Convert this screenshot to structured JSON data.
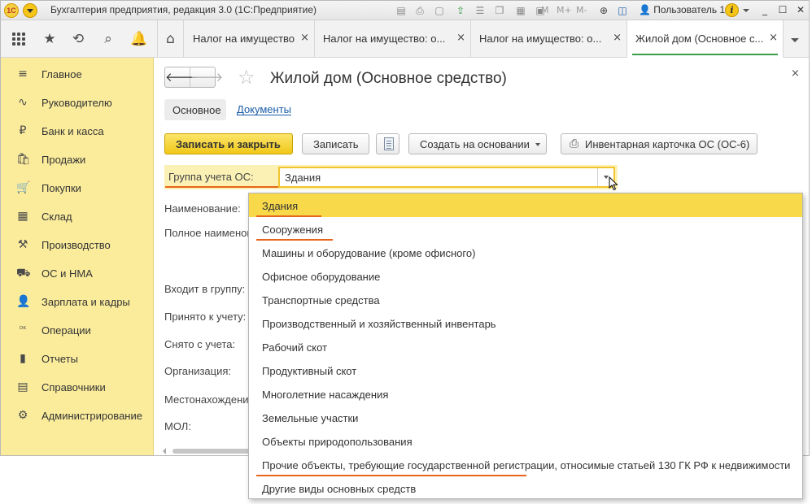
{
  "window": {
    "title": "Бухгалтерия предприятия, редакция 3.0  (1С:Предприятие)",
    "logo_text": "1С",
    "m_labels": [
      "M",
      "M+",
      "M-"
    ],
    "user": "Пользователь 1"
  },
  "tabs": [
    {
      "label": "Налог на имущество",
      "close": "×"
    },
    {
      "label": "Налог на имущество: о...",
      "close": "×"
    },
    {
      "label": "Налог на имущество: о...",
      "close": "×"
    },
    {
      "label": "Жилой дом (Основное с...",
      "close": "×",
      "active": true
    }
  ],
  "sidebar": {
    "items": [
      {
        "label": "Главное",
        "icon": "menu-lines-icon",
        "glyph": "≡"
      },
      {
        "label": "Руководителю",
        "icon": "chart-line-icon",
        "glyph": "∿"
      },
      {
        "label": "Банк и касса",
        "icon": "coin-icon",
        "glyph": "₽"
      },
      {
        "label": "Продажи",
        "icon": "cart-out-icon",
        "glyph": "🛍"
      },
      {
        "label": "Покупки",
        "icon": "cart-icon",
        "glyph": "🛒"
      },
      {
        "label": "Склад",
        "icon": "warehouse-icon",
        "glyph": "▦"
      },
      {
        "label": "Производство",
        "icon": "factory-icon",
        "glyph": "⚒"
      },
      {
        "label": "ОС и НМА",
        "icon": "car-icon",
        "glyph": "⛟"
      },
      {
        "label": "Зарплата и кадры",
        "icon": "person-icon",
        "glyph": "👤"
      },
      {
        "label": "Операции",
        "icon": "dt-kt-icon",
        "glyph": "ᴰᴷ"
      },
      {
        "label": "Отчеты",
        "icon": "bar-chart-icon",
        "glyph": "▮"
      },
      {
        "label": "Справочники",
        "icon": "book-icon",
        "glyph": "▤"
      },
      {
        "label": "Администрирование",
        "icon": "gear-icon",
        "glyph": "⚙"
      }
    ]
  },
  "form": {
    "title": "Жилой дом (Основное средство)",
    "close": "×",
    "subtabs": {
      "main": "Основное",
      "docs": "Документы"
    },
    "buttons": {
      "save_close": "Записать и закрыть",
      "save": "Записать",
      "create_based": "Создать на основании",
      "inventory_card": "Инвентарная карточка ОС (ОС-6)"
    },
    "fields": {
      "group_label": "Группа учета ОС:",
      "group_value": "Здания",
      "name_label": "Наименование:",
      "full_name_label": "Полное наименов",
      "parent_label": "Входит в группу:",
      "accepted_label": "Принято к учету:",
      "removed_label": "Снято с учета:",
      "org_label": "Организация:",
      "location_label": "Местонахождени",
      "mol_label": "МОЛ:"
    }
  },
  "dropdown": {
    "selected": "Здания",
    "options": [
      "Здания",
      "Сооружения",
      "Машины и оборудование (кроме офисного)",
      "Офисное оборудование",
      "Транспортные средства",
      "Производственный и хозяйственный инвентарь",
      "Рабочий скот",
      "Продуктивный скот",
      "Многолетние насаждения",
      "Земельные участки",
      "Объекты природопользования",
      "Прочие объекты, требующие государственной регистрации, относимые статьей 130 ГК РФ к недвижимости",
      "Другие виды основных средств"
    ]
  },
  "colors": {
    "accent_yellow": "#f8d94a",
    "sidebar_bg": "#fbec9c",
    "highlight_orange": "#e8641b",
    "active_tab_green": "#3a9d4a",
    "link_blue": "#1a5ca8"
  }
}
